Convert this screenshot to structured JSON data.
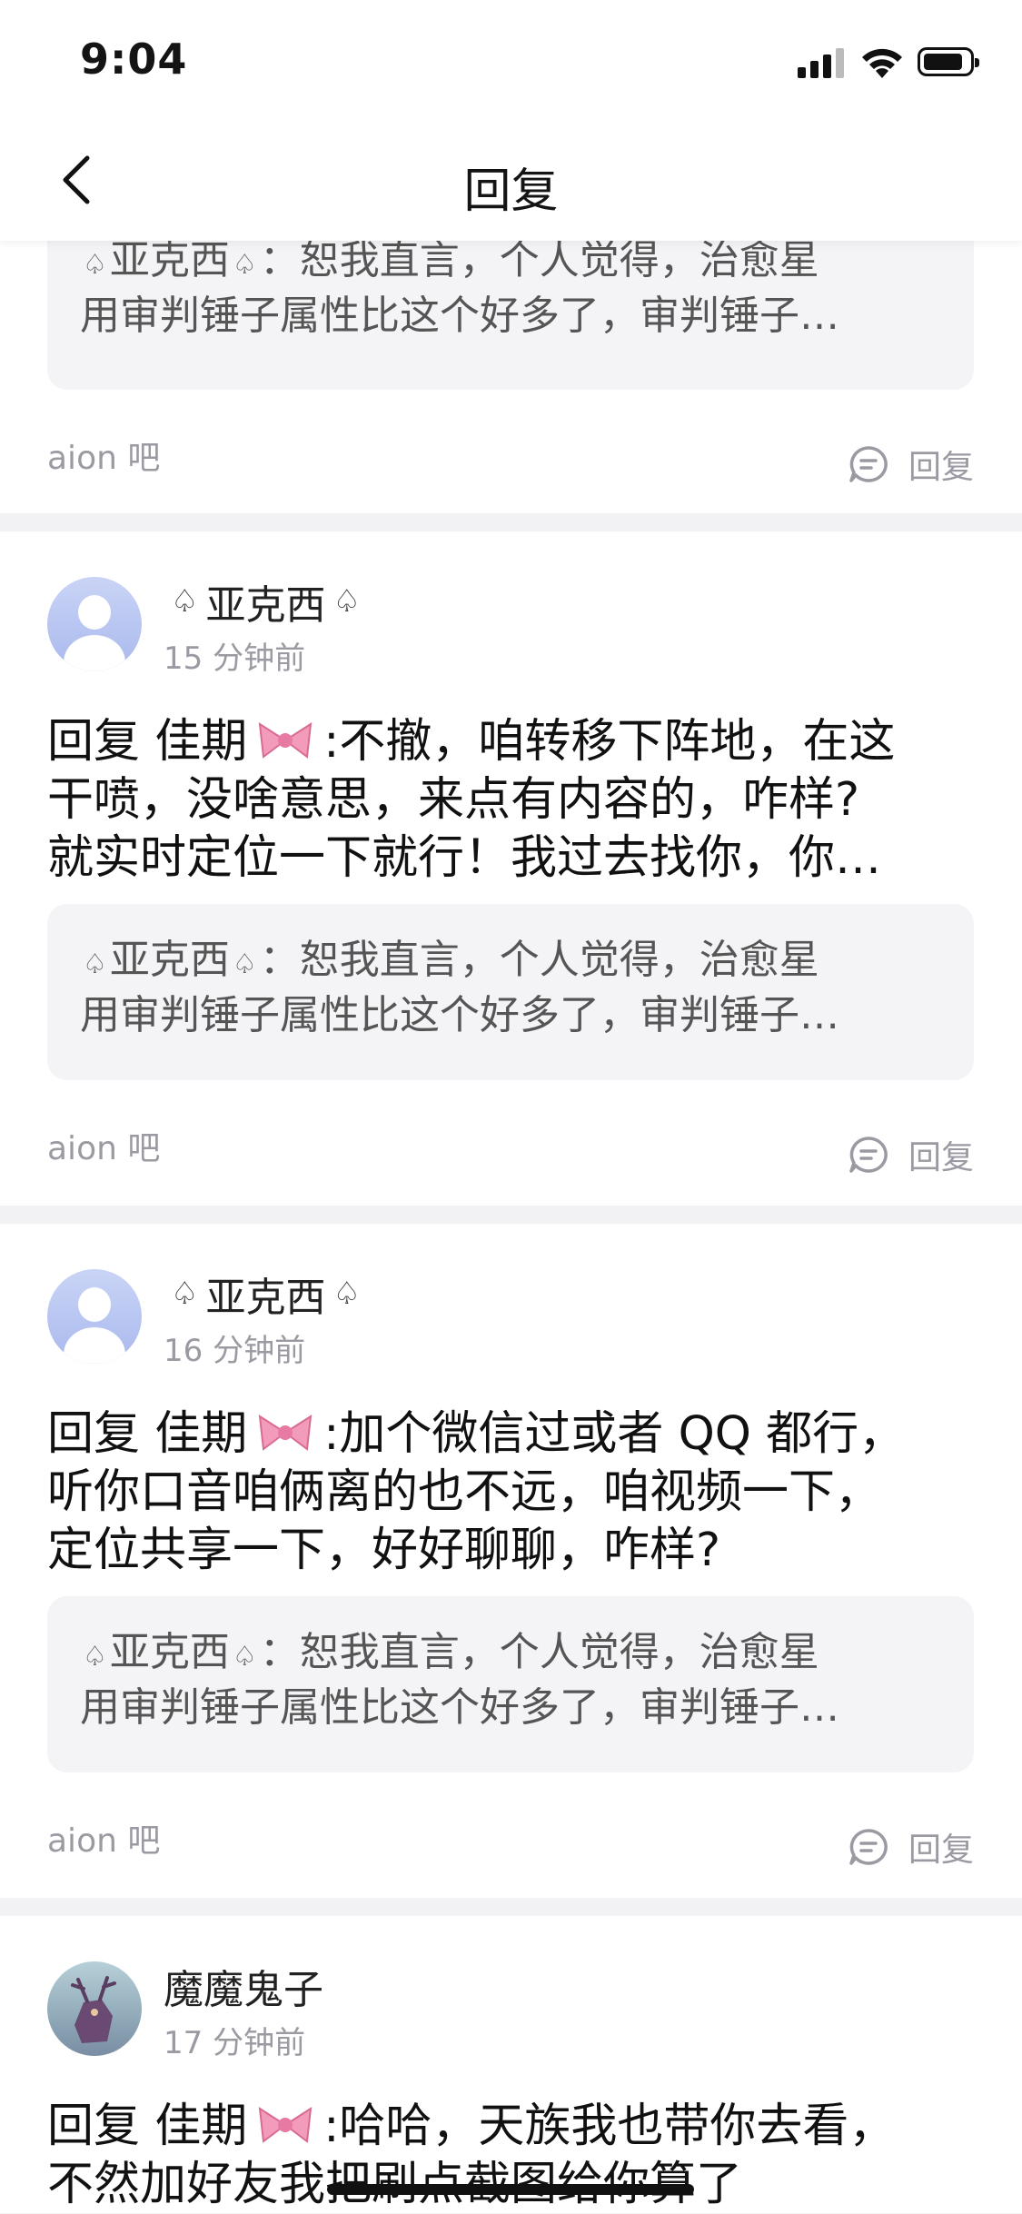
{
  "status": {
    "time": "9:04"
  },
  "nav": {
    "title": "回复"
  },
  "colors": {
    "background": "#f2f2f5",
    "card": "#ffffff",
    "quote_bg": "#f4f4f7",
    "muted": "#9a9aa2"
  },
  "icons": {
    "back": "chevron-left-icon",
    "reply": "comment-icon",
    "bow": "pink-bow-emoji",
    "spade": "spade-outline-icon"
  },
  "card0": {
    "quote_user": "亚克西",
    "quote_line1": "：恕我直言，个人觉得，治愈星",
    "quote_line2": "用审判锤子属性比这个好多了，审判锤子…",
    "forum": "aion 吧",
    "reply_label": "回复"
  },
  "posts": [
    {
      "user": "亚克西",
      "time": "15 分钟前",
      "reply_prefix": "回复 佳期",
      "line1": ":不撤，咱转移下阵地，在这",
      "line2": "干喷，没啥意思，来点有内容的，咋样?",
      "line3": "就实时定位一下就行！我过去找你，你…",
      "quote_user": "亚克西",
      "quote_line1": "：恕我直言，个人觉得，治愈星",
      "quote_line2": "用审判锤子属性比这个好多了，审判锤子…",
      "forum": "aion 吧",
      "reply_label": "回复"
    },
    {
      "user": "亚克西",
      "time": "16 分钟前",
      "reply_prefix": "回复 佳期",
      "line1": ":加个微信过或者 QQ 都行，",
      "line2": "听你口音咱俩离的也不远，咱视频一下，",
      "line3": "定位共享一下，好好聊聊，咋样?",
      "quote_user": "亚克西",
      "quote_line1": "：恕我直言，个人觉得，治愈星",
      "quote_line2": "用审判锤子属性比这个好多了，审判锤子…",
      "forum": "aion 吧",
      "reply_label": "回复"
    },
    {
      "user": "魔魔鬼子",
      "time": "17 分钟前",
      "reply_prefix": "回复 佳期",
      "line1": ":哈哈，天族我也带你去看，",
      "line2": "不然加好友我把刷点截图给你算了"
    }
  ]
}
